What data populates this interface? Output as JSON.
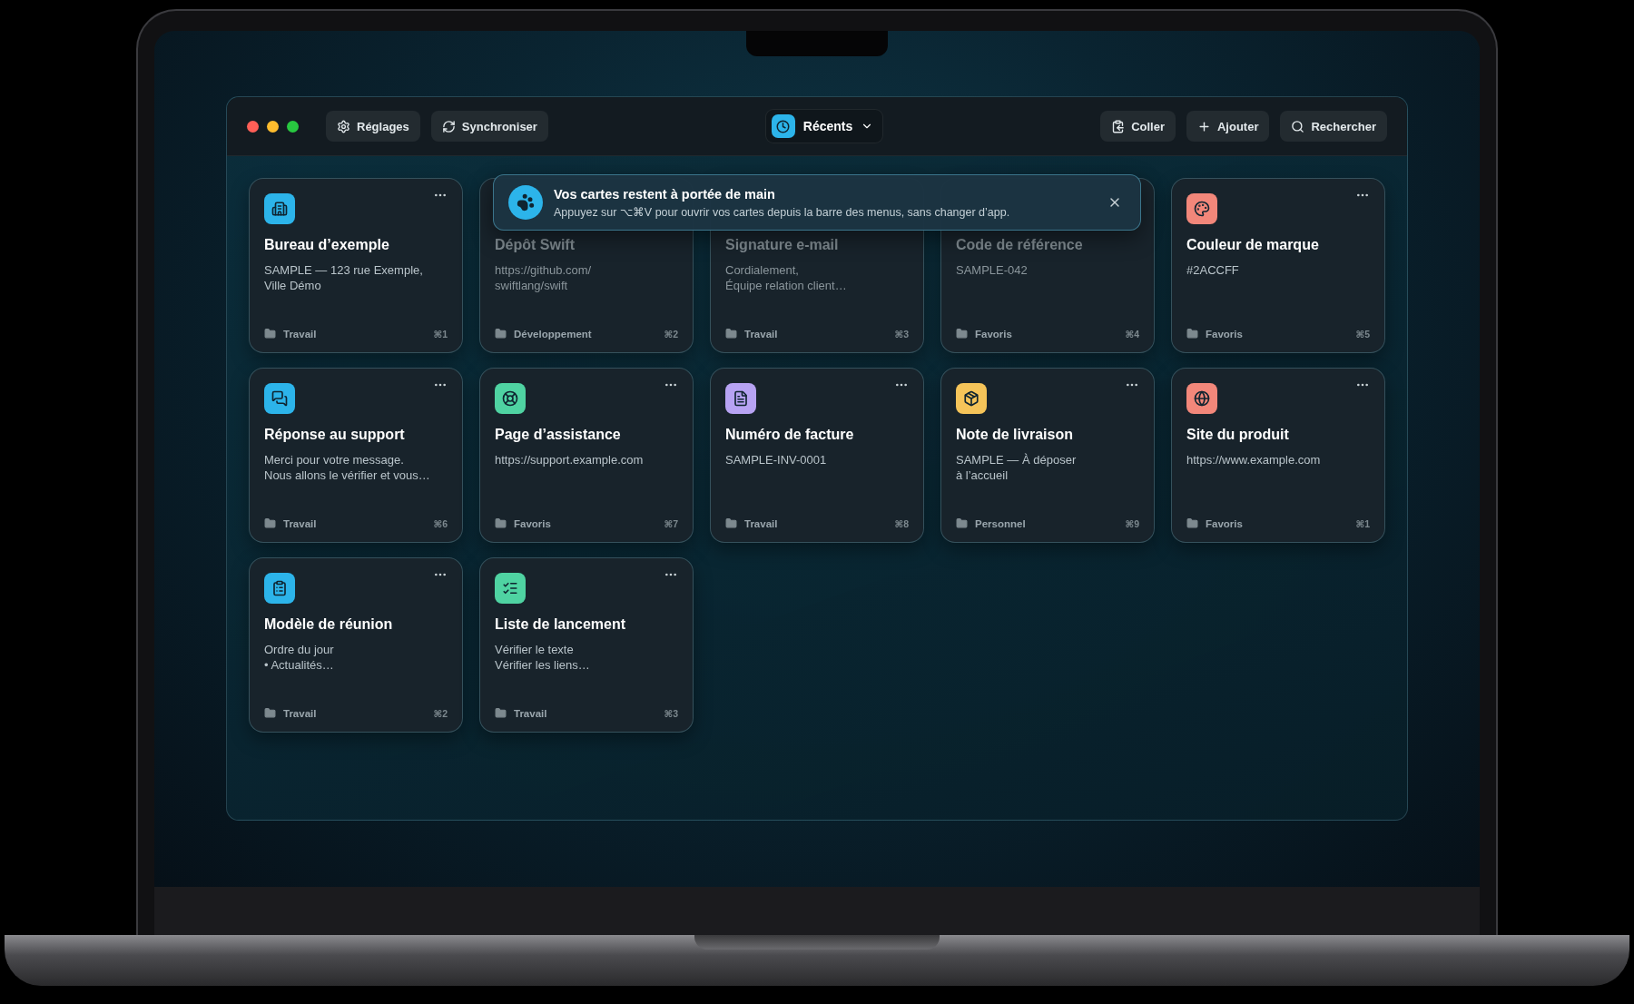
{
  "window": {
    "traffic_lights": [
      {
        "color": "#ff5f57"
      },
      {
        "color": "#febc2e"
      },
      {
        "color": "#28c840"
      }
    ]
  },
  "toolbar": {
    "left": [
      {
        "kind": "settings",
        "label": "Réglages"
      },
      {
        "kind": "sync",
        "label": "Synchroniser"
      }
    ],
    "center": {
      "label": "Récents"
    },
    "right": [
      {
        "kind": "paste",
        "label": "Coller"
      },
      {
        "kind": "add",
        "label": "Ajouter"
      },
      {
        "kind": "search",
        "label": "Rechercher"
      }
    ]
  },
  "toast": {
    "title": "Vos cartes restent à portée de main",
    "message": "Appuyez sur ⌥⌘V pour ouvrir vos cartes depuis la barre des menus, sans changer d’app."
  },
  "cards": [
    {
      "kind": "building",
      "color": "#2cb4ea",
      "covered": false,
      "title": "Bureau d’exemple",
      "lines": [
        "SAMPLE — 123 rue Exemple,",
        "Ville Démo"
      ],
      "folder": "Travail",
      "shortcut": "⌘1"
    },
    {
      "covered": true,
      "title": "Dépôt Swift",
      "lines": [
        "https://github.com/",
        "swiftlang/swift"
      ],
      "folder": "Développement",
      "shortcut": "⌘2"
    },
    {
      "covered": true,
      "title": "Signature e-mail",
      "lines": [
        "Cordialement,",
        "Équipe relation client…"
      ],
      "folder": "Travail",
      "shortcut": "⌘3"
    },
    {
      "covered": true,
      "title": "Code de référence",
      "lines": [
        "SAMPLE-042"
      ],
      "folder": "Favoris",
      "shortcut": "⌘4"
    },
    {
      "kind": "palette",
      "color": "#f2877a",
      "covered": false,
      "title": "Couleur de marque",
      "lines": [
        "#2ACCFF"
      ],
      "folder": "Favoris",
      "shortcut": "⌘5"
    },
    {
      "kind": "chat",
      "color": "#2cb4ea",
      "covered": false,
      "title": "Réponse au support",
      "lines": [
        "Merci pour votre message.",
        "Nous allons le vérifier et vous…"
      ],
      "folder": "Travail",
      "shortcut": "⌘6"
    },
    {
      "kind": "lifebuoy",
      "color": "#4fd3a2",
      "covered": false,
      "title": "Page d’assistance",
      "lines": [
        "https://support.example.com"
      ],
      "folder": "Favoris",
      "shortcut": "⌘7"
    },
    {
      "kind": "document",
      "color": "#b7a3f3",
      "covered": false,
      "title": "Numéro de facture",
      "lines": [
        "SAMPLE-INV-0001"
      ],
      "folder": "Travail",
      "shortcut": "⌘8"
    },
    {
      "kind": "box",
      "color": "#f5c459",
      "covered": false,
      "title": "Note de livraison",
      "lines": [
        "SAMPLE — À déposer",
        "à l’accueil"
      ],
      "folder": "Personnel",
      "shortcut": "⌘9"
    },
    {
      "kind": "globe",
      "color": "#f2877a",
      "covered": false,
      "title": "Site du produit",
      "lines": [
        "https://www.example.com"
      ],
      "folder": "Favoris",
      "shortcut": "⌘1"
    },
    {
      "kind": "clipboard",
      "color": "#2cb4ea",
      "covered": false,
      "title": "Modèle de réunion",
      "lines": [
        "Ordre du jour",
        "• Actualités…"
      ],
      "folder": "Travail",
      "shortcut": "⌘2"
    },
    {
      "kind": "checklist",
      "color": "#4fd3a2",
      "covered": false,
      "title": "Liste de lancement",
      "lines": [
        "Vérifier le texte",
        "Vérifier les liens…"
      ],
      "folder": "Travail",
      "shortcut": "⌘3"
    }
  ]
}
